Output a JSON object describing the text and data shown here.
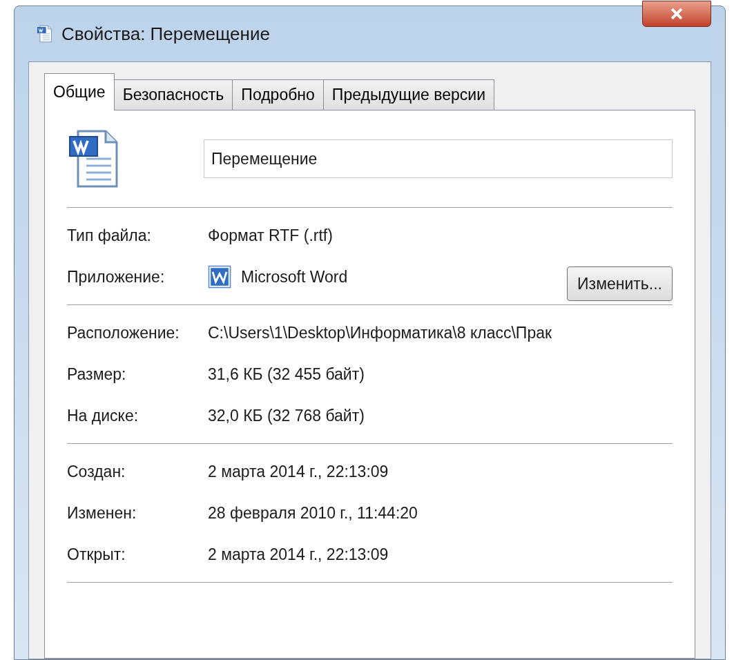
{
  "window": {
    "title": "Свойства: Перемещение"
  },
  "tabs": [
    {
      "label": "Общие",
      "selected": true
    },
    {
      "label": "Безопасность",
      "selected": false
    },
    {
      "label": "Подробно",
      "selected": false
    },
    {
      "label": "Предыдущие версии",
      "selected": false
    }
  ],
  "file_name": {
    "value": "Перемещение"
  },
  "sections": [
    {
      "rows": [
        {
          "kind": "text",
          "label": "Тип файла:",
          "value": "Формат RTF (.rtf)"
        },
        {
          "kind": "app",
          "label": "Приложение:",
          "value": "Microsoft Word",
          "button": "Изменить..."
        }
      ]
    },
    {
      "rows": [
        {
          "kind": "text",
          "label": "Расположение:",
          "value": "C:\\Users\\1\\Desktop\\Информатика\\8 класс\\Прак"
        },
        {
          "kind": "text",
          "label": "Размер:",
          "value": "31,6 КБ (32 455 байт)"
        },
        {
          "kind": "text",
          "label": "На диске:",
          "value": "32,0 КБ (32 768 байт)"
        }
      ]
    },
    {
      "rows": [
        {
          "kind": "text",
          "label": "Создан:",
          "value": "2 марта 2014 г., 22:13:09"
        },
        {
          "kind": "text",
          "label": "Изменен:",
          "value": "28 февраля 2010 г., 11:44:20"
        },
        {
          "kind": "text",
          "label": "Открыт:",
          "value": "2 марта 2014 г., 22:13:09"
        }
      ]
    }
  ]
}
